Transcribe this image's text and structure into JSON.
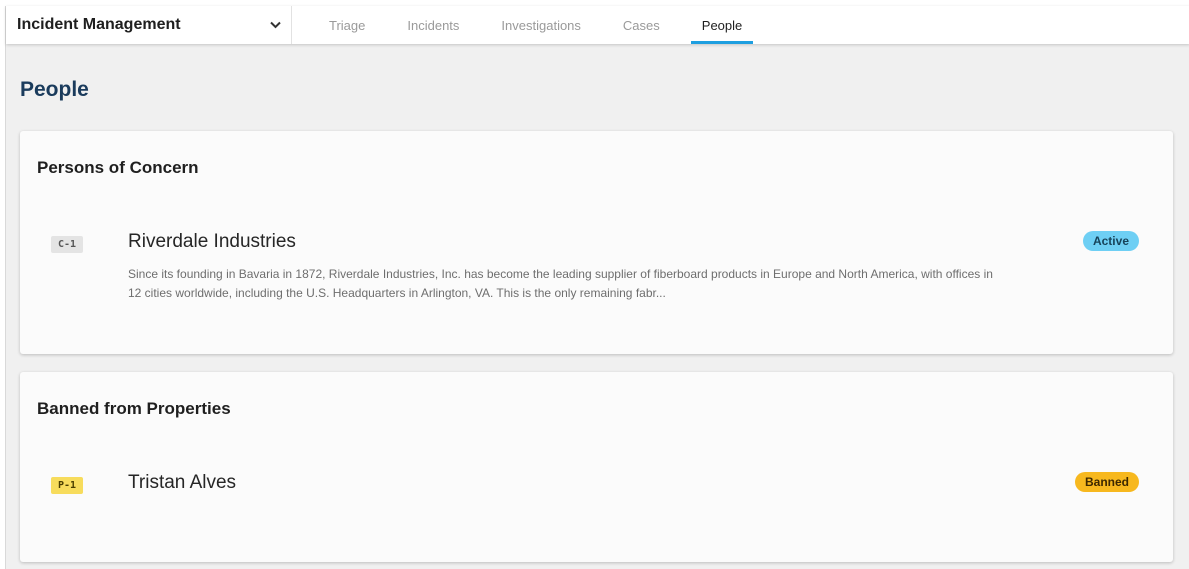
{
  "header": {
    "module": "Incident Management",
    "tabs": [
      {
        "label": "Triage"
      },
      {
        "label": "Incidents"
      },
      {
        "label": "Investigations"
      },
      {
        "label": "Cases"
      },
      {
        "label": "People"
      }
    ],
    "active_tab": "People"
  },
  "page": {
    "title": "People"
  },
  "sections": [
    {
      "title": "Persons of Concern",
      "records": [
        {
          "id": "C-1",
          "name": "Riverdale Industries",
          "description": "Since its founding in Bavaria in 1872, Riverdale Industries, Inc. has become the leading supplier of fiberboard products in Europe and North America, with offices in 12 cities worldwide, including the U.S. Headquarters in Arlington, VA. This is the only remaining fabr...",
          "status": "Active"
        }
      ]
    },
    {
      "title": "Banned from Properties",
      "records": [
        {
          "id": "P-1",
          "name": "Tristan Alves",
          "status": "Banned"
        }
      ]
    }
  ],
  "colors": {
    "accent": "#1e9fe0",
    "title": "#1a3b5c",
    "status_active": "#6ecff4",
    "status_banned": "#f7b81e",
    "badge_person": "#f7dc5c"
  }
}
